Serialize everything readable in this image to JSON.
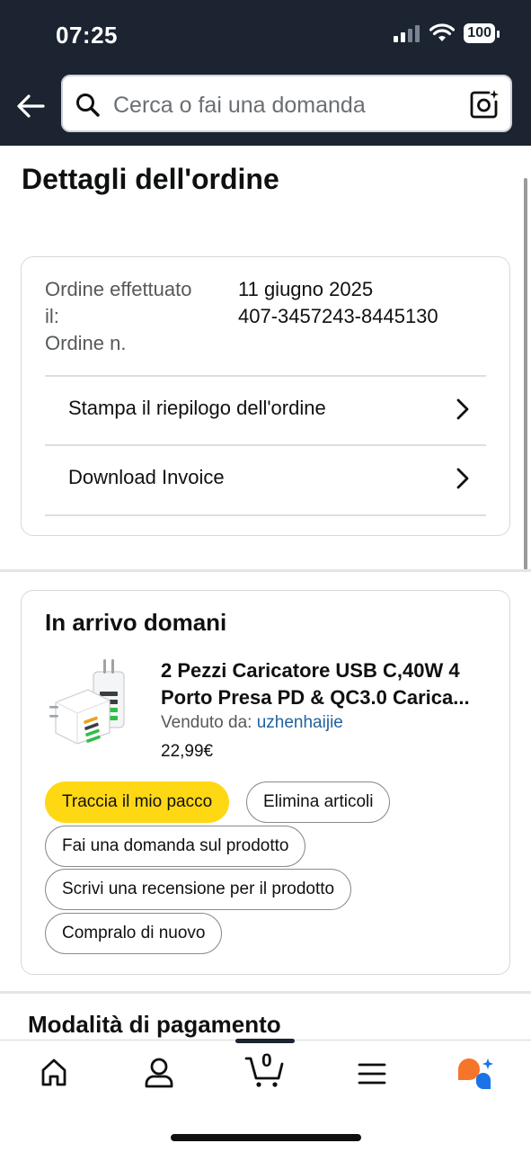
{
  "status": {
    "time": "07:25",
    "battery": "100"
  },
  "search": {
    "placeholder": "Cerca o fai una domanda"
  },
  "page": {
    "title": "Dettagli dell'ordine"
  },
  "order": {
    "placed_label_1": "Ordine effettuato",
    "placed_label_2": "il:",
    "number_label": "Ordine n.",
    "placed_date": "11 giugno 2025",
    "number": "407-3457243-8445130",
    "actions": [
      {
        "label": "Stampa il riepilogo dell'ordine"
      },
      {
        "label": "Download Invoice"
      }
    ]
  },
  "shipment": {
    "status": "In arrivo domani",
    "product": {
      "title": "2 Pezzi Caricatore USB C,40W 4 Porto Presa PD & QC3.0 Carica...",
      "seller_label": "Venduto da:",
      "seller": "uzhenhaijie",
      "price": "22,99€"
    },
    "buttons": {
      "track": "Traccia il mio pacco",
      "delete": "Elimina articoli",
      "ask": "Fai una domanda sul prodotto",
      "review": "Scrivi una recensione per il prodotto",
      "buy_again": "Compralo di nuovo"
    }
  },
  "payment": {
    "title": "Modalità di pagamento"
  },
  "nav": {
    "cart_count": "0"
  },
  "colors": {
    "header_bg": "#1b2430",
    "accent_yellow": "#ffd814",
    "link": "#2162a1",
    "ai_orange": "#f7752a",
    "ai_blue": "#1a73e8"
  }
}
